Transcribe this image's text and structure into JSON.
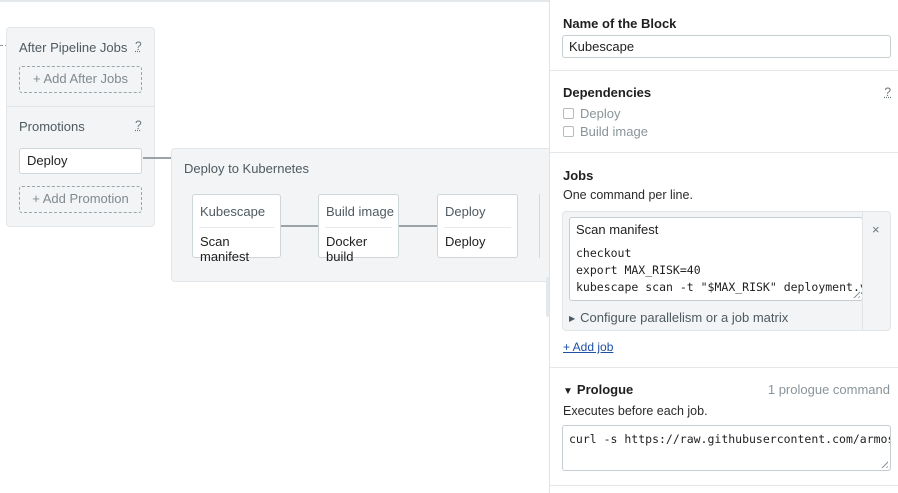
{
  "canvas": {
    "after_pipeline": {
      "title": "After Pipeline Jobs",
      "help": "?",
      "add_button": "+ Add After Jobs"
    },
    "promotions": {
      "title": "Promotions",
      "help": "?",
      "items": [
        "Deploy"
      ],
      "add_button": "+ Add Promotion"
    },
    "deploy_pipeline": {
      "title": "Deploy to Kubernetes",
      "blocks": [
        {
          "name": "Kubescape",
          "job": "Scan manifest"
        },
        {
          "name": "Build image",
          "job": "Docker build"
        },
        {
          "name": "Deploy",
          "job": "Deploy"
        }
      ]
    }
  },
  "sidebar": {
    "block_name": {
      "label": "Name of the Block",
      "value": "Kubescape"
    },
    "dependencies": {
      "label": "Dependencies",
      "help": "?",
      "options": [
        {
          "label": "Deploy",
          "checked": false
        },
        {
          "label": "Build image",
          "checked": false
        }
      ]
    },
    "jobs": {
      "label": "Jobs",
      "subtitle": "One command per line.",
      "items": [
        {
          "name": "Scan manifest",
          "commands": [
            "checkout",
            "export MAX_RISK=40",
            "kubescape scan -t \"$MAX_RISK\" deployment.ym"
          ]
        }
      ],
      "close_icon": "×",
      "parallelism_link": "Configure parallelism or a job matrix",
      "add_job": "+ Add job"
    },
    "prologue": {
      "label": "Prologue",
      "count": "1 prologue command",
      "description": "Executes before each job.",
      "command": "curl -s https://raw.githubusercontent.com/armose"
    }
  },
  "colors": {
    "panel_bg": "#f2f4f5",
    "border": "#cfd6da",
    "link": "#1f4fa3",
    "muted_text": "#8a9499"
  }
}
